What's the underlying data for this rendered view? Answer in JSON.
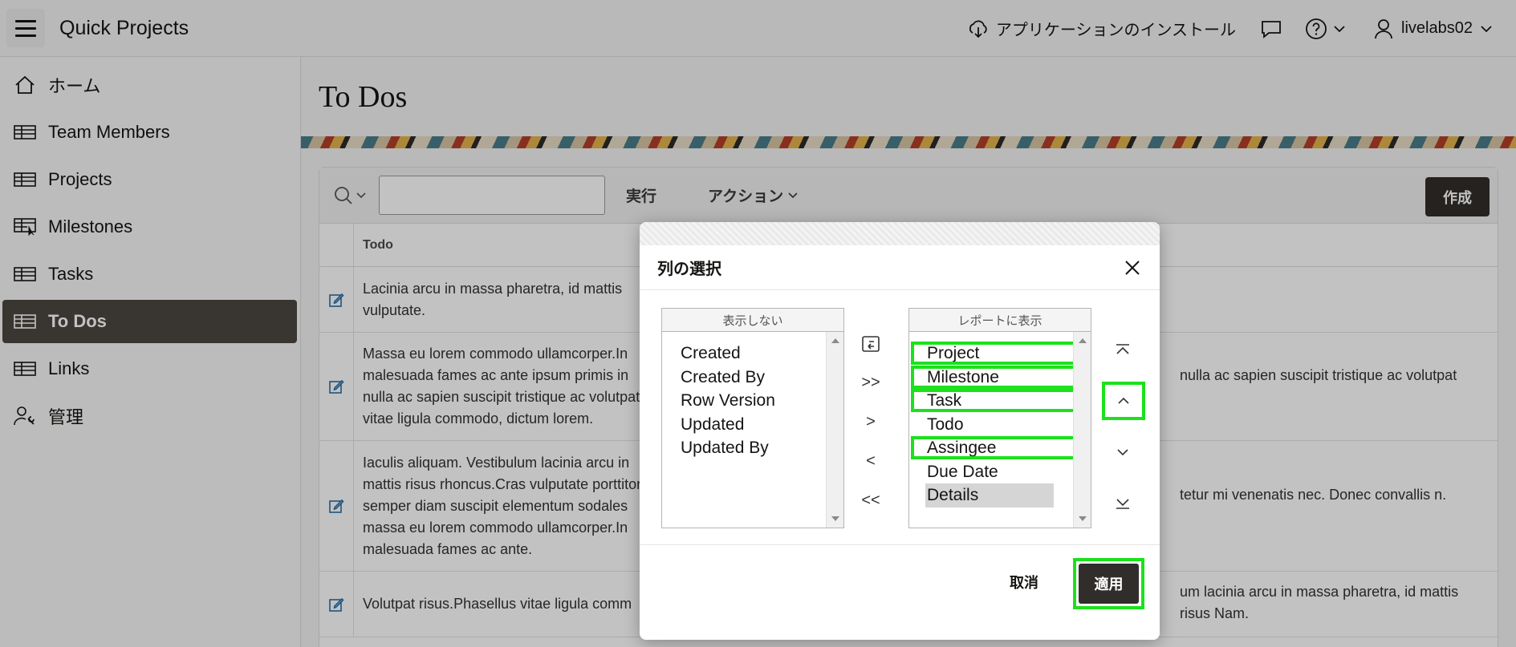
{
  "header": {
    "app_title": "Quick Projects",
    "install_label": "アプリケーションのインストール",
    "user_name": "livelabs02"
  },
  "sidebar": {
    "items": [
      {
        "label": "ホーム",
        "icon": "home-icon"
      },
      {
        "label": "Team Members",
        "icon": "table-icon"
      },
      {
        "label": "Projects",
        "icon": "table-icon"
      },
      {
        "label": "Milestones",
        "icon": "table-cursor-icon"
      },
      {
        "label": "Tasks",
        "icon": "table-icon"
      },
      {
        "label": "To Dos",
        "icon": "table-icon",
        "active": true
      },
      {
        "label": "Links",
        "icon": "table-icon"
      },
      {
        "label": "管理",
        "icon": "user-wrench-icon"
      }
    ]
  },
  "main": {
    "page_title": "To Dos",
    "toolbar": {
      "run_label": "実行",
      "actions_label": "アクション",
      "create_label": "作成"
    },
    "table": {
      "column_todo": "Todo",
      "rows": [
        {
          "todo": "Lacinia arcu in massa pharetra, id mattis vulputate.",
          "right": ""
        },
        {
          "todo": "Massa eu lorem commodo ullamcorper.In malesuada fames ac ante ipsum primis in nulla ac sapien suscipit tristique ac volutpat vitae ligula commodo, dictum lorem.",
          "right": "nulla ac sapien suscipit tristique ac volutpat"
        },
        {
          "todo": "Iaculis aliquam. Vestibulum lacinia arcu in mattis risus rhoncus.Cras vulputate porttitor semper diam suscipit elementum sodales massa eu lorem commodo ullamcorper.In malesuada fames ac ante.",
          "right": "tetur mi venenatis nec. Donec convallis n."
        },
        {
          "todo": "Volutpat risus.Phasellus vitae ligula comm",
          "right": "um lacinia arcu in massa pharetra, id mattis risus Nam."
        }
      ]
    }
  },
  "dialog": {
    "title": "列の選択",
    "hidden_caption": "表示しない",
    "shown_caption": "レポートに表示",
    "hidden_columns": [
      "Created",
      "Created By",
      "Row Version",
      "Updated",
      "Updated By"
    ],
    "shown_columns": [
      {
        "label": "Project",
        "highlight": true
      },
      {
        "label": "Milestone",
        "highlight": true
      },
      {
        "label": "Task",
        "highlight": true
      },
      {
        "label": "Todo",
        "highlight": false
      },
      {
        "label": "Assingee",
        "highlight": true
      },
      {
        "label": "Due Date",
        "highlight": false
      },
      {
        "label": "Details",
        "highlight": false,
        "selected": true
      }
    ],
    "shuttle_buttons": [
      "↶",
      ">>",
      ">",
      "<",
      "<<"
    ],
    "cancel_label": "取消",
    "apply_label": "適用",
    "highlight_color": "#1ce11c"
  }
}
